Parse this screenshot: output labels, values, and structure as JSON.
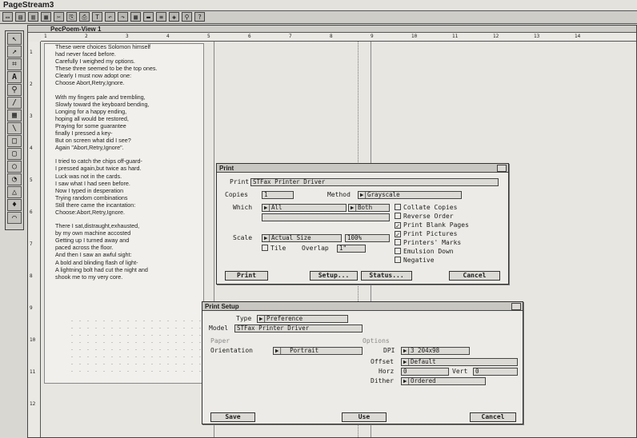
{
  "app": {
    "title": "PageStream3"
  },
  "toolbar": {
    "icons": [
      "new-icon",
      "open-icon",
      "save-icon",
      "print-icon",
      "cut-icon",
      "copy-icon",
      "paste-icon",
      "text-icon",
      "undo-icon",
      "redo-icon",
      "grid-icon",
      "ruler-icon",
      "align-icon",
      "layer-icon",
      "zoom-icon",
      "help-icon"
    ]
  },
  "document": {
    "window_title": "PecPoem-View 1",
    "ruler_top": [
      "1",
      "2",
      "3",
      "4",
      "5",
      "6",
      "7",
      "8",
      "9",
      "10",
      "11",
      "12",
      "13",
      "14"
    ],
    "ruler_left": [
      "1",
      "2",
      "3",
      "4",
      "5",
      "6",
      "7",
      "8",
      "9",
      "10",
      "11",
      "12"
    ],
    "poem": [
      "These were choices Solomon himself",
      "had never faced before.",
      "Carefully I weighed my options.",
      "These three seemed to be the top ones.",
      "Clearly I must now adopt one:",
      "Choose Abort,Retry,Ignore.",
      "",
      "With my fingers pale and trembling,",
      "Slowly toward the keyboard bending,",
      "Longing for a happy ending,",
      "hoping all would be restored,",
      "Praying for some guarantee",
      "finally I pressed a key-",
      "But on screen what did I see?",
      "Again \"Abort,Retry,Ignore\".",
      "",
      "I tried to catch the chips off-guard-",
      "I pressed again,but twice as hard.",
      "Luck was not in the cards.",
      "I saw what I had seen before.",
      "Now I typed in desperation",
      "Trying random combinations",
      "Still there came the incantation:",
      "Choose:Abort,Retry,Ignore.",
      "",
      "There I sat,distraught,exhausted,",
      "by my own machine accosted",
      "Getting up I turned away and",
      "paced across the floor.",
      "And then I saw an awful sight:",
      "A bold and blinding flash of light-",
      "A lightning bolt had cut the night and",
      "shook me to my very core."
    ]
  },
  "print_dialog": {
    "title": "Print",
    "print_label": "Print",
    "printer": "STFax Printer Driver",
    "copies_label": "Copies",
    "copies_value": "1",
    "method_label": "Method",
    "method_value": "Grayscale",
    "which_label": "Which",
    "which_value": "All",
    "sides_value": "Both",
    "scale_label": "Scale",
    "scale_value": "Actual Size",
    "scale_percent": "100%",
    "tile_label": "Tile",
    "overlap_label": "Overlap",
    "overlap_value": "1\"",
    "options": [
      {
        "label": "Collate Copies",
        "checked": false
      },
      {
        "label": "Reverse Order",
        "checked": false
      },
      {
        "label": "Print Blank Pages",
        "checked": true
      },
      {
        "label": "Print Pictures",
        "checked": true
      },
      {
        "label": "Printers' Marks",
        "checked": false
      },
      {
        "label": "Emulsion Down",
        "checked": false
      },
      {
        "label": "Negative",
        "checked": false
      }
    ],
    "btn_print": "Print",
    "btn_setup": "Setup...",
    "btn_status": "Status...",
    "btn_cancel": "Cancel"
  },
  "setup_dialog": {
    "title": "Print Setup",
    "type_label": "Type",
    "type_value": "Preference",
    "model_label": "Model",
    "model_value": "STFax Printer Driver",
    "paper_label": "Paper",
    "options_label": "Options",
    "orientation_label": "Orientation",
    "orientation_value": "Portrait",
    "dpi_label": "DPI",
    "dpi_value": "3  204x98",
    "offset_label": "Offset",
    "offset_value": "Default",
    "horz_label": "Horz",
    "horz_value": "0",
    "vert_label": "Vert",
    "vert_value": "0",
    "dither_label": "Dither",
    "dither_value": "Ordered",
    "btn_save": "Save",
    "btn_use": "Use",
    "btn_cancel": "Cancel"
  }
}
